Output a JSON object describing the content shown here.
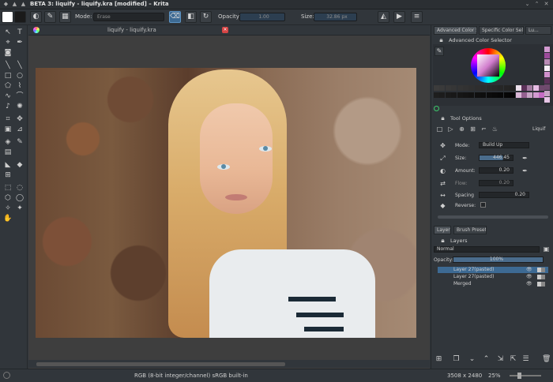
{
  "window": {
    "title": "BETA 3: liquify - liquify.kra [modified] – Krita"
  },
  "toolbar": {
    "mode_label": "Mode:",
    "mode_value": "Erase",
    "opacity_label": "Opacity:",
    "opacity_value": "1.00",
    "size_label": "Size:",
    "size_value": "32.86 px"
  },
  "document": {
    "tab_title": "liquify - liquify.kra"
  },
  "right_panel": {
    "tabs": [
      "Advanced Color Sel...",
      "Specific Color Sel...",
      "Lu..."
    ],
    "color_selector_title": "Advanced Color Selector",
    "tool_options_title": "Tool Options",
    "tool_options_mode_right": "Liquif",
    "options": {
      "mode_label": "Mode:",
      "mode_value": "Build Up",
      "size_label": "Size:",
      "size_value": "446.45",
      "amount_label": "Amount:",
      "amount_value": "0.20",
      "flow_label": "Flow:",
      "flow_value": "0.20",
      "spacing_label": "Spacing",
      "spacing_value": "0.20",
      "reverse_label": "Reverse:"
    },
    "layer_tabs": [
      "Layers",
      "Brush Presets"
    ],
    "layers_title": "Layers",
    "blend_mode": "Normal",
    "opacity_label": "Opacity:",
    "opacity_value": "100%",
    "layers": [
      {
        "name": "Layer 27(pasted)",
        "selected": true
      },
      {
        "name": "Layer 27(pasted)",
        "selected": false
      },
      {
        "name": "Merged",
        "selected": false
      }
    ]
  },
  "status": {
    "color_space": "RGB (8-bit integer/channel)  sRGB built-in",
    "dimensions": "3508 x 2480",
    "zoom": "25%"
  },
  "colors": {
    "accent": "#3d6a93",
    "panel": "#31363b",
    "canvas_bg": "#3e3e3e"
  },
  "swatches": [
    "#d29ad0",
    "#c56cc4",
    "#e8c6e6",
    "#9c4a9a",
    "#f3def1",
    "#6a2e6a",
    "#b98ab5",
    "#e0a9dd",
    "#7d3e7b",
    "#f8eef7",
    "#4f224e",
    "#ac66a9",
    "#cf8fcc",
    "#8d548b",
    "#ede1ec",
    "#5c3159",
    "#a27ba0",
    "#e6bce3",
    "#6f4a6d",
    "#d9b6d6",
    "#93608f",
    "#c6a3c4"
  ]
}
